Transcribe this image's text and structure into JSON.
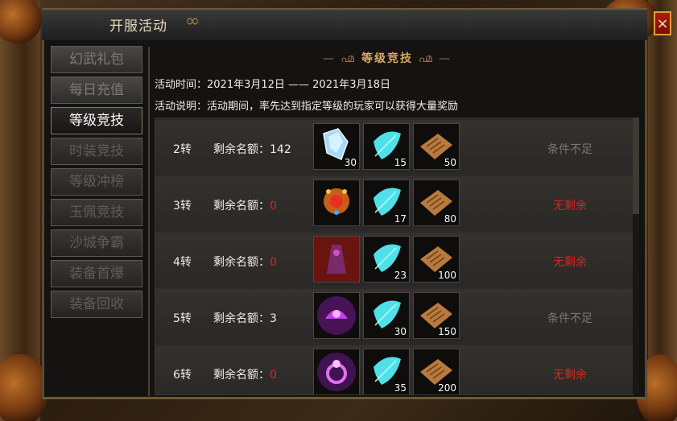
{
  "window": {
    "title": "开服活动",
    "close_label": "×"
  },
  "sidebar": {
    "items": [
      {
        "label": "幻武礼包",
        "state": "normal"
      },
      {
        "label": "每日充值",
        "state": "normal"
      },
      {
        "label": "等级竞技",
        "state": "active"
      },
      {
        "label": "时装竞技",
        "state": "dim"
      },
      {
        "label": "等级冲榜",
        "state": "dim"
      },
      {
        "label": "玉佩竞技",
        "state": "dim"
      },
      {
        "label": "沙城争霸",
        "state": "dim"
      },
      {
        "label": "装备首爆",
        "state": "dim"
      },
      {
        "label": "装备回收",
        "state": "dim"
      }
    ]
  },
  "content": {
    "section_title": "等级竞技",
    "ornament_left": "— ൶",
    "ornament_right": "൶ —",
    "time_label": "活动时间：2021年3月12日 —— 2021年3月18日",
    "desc_label": "活动说明：活动期间，率先达到指定等级的玩家可以获得大量奖励",
    "quota_prefix": "剩余名额：",
    "rows": [
      {
        "level": "2转",
        "quota": "142",
        "rewards": [
          {
            "icon": "crystal-icon",
            "count": "30"
          },
          {
            "icon": "feather-icon",
            "count": "15"
          },
          {
            "icon": "scroll-icon",
            "count": "50"
          }
        ],
        "status": "条件不足",
        "status_type": "fail"
      },
      {
        "level": "3转",
        "quota": "0",
        "rewards": [
          {
            "icon": "gem-amulet-icon",
            "count": ""
          },
          {
            "icon": "feather-icon",
            "count": "17"
          },
          {
            "icon": "scroll-icon",
            "count": "80"
          }
        ],
        "status": "无剩余",
        "status_type": "none"
      },
      {
        "level": "4转",
        "quota": "0",
        "rewards": [
          {
            "icon": "robe-icon",
            "count": ""
          },
          {
            "icon": "feather-icon",
            "count": "23"
          },
          {
            "icon": "scroll-icon",
            "count": "100"
          }
        ],
        "status": "无剩余",
        "status_type": "none"
      },
      {
        "level": "5转",
        "quota": "3",
        "rewards": [
          {
            "icon": "purple-helmet-icon",
            "count": ""
          },
          {
            "icon": "feather-icon",
            "count": "30"
          },
          {
            "icon": "scroll-icon",
            "count": "150"
          }
        ],
        "status": "条件不足",
        "status_type": "fail"
      },
      {
        "level": "6转",
        "quota": "0",
        "rewards": [
          {
            "icon": "purple-ring-icon",
            "count": ""
          },
          {
            "icon": "feather-icon",
            "count": "35"
          },
          {
            "icon": "scroll-icon",
            "count": "200"
          }
        ],
        "status": "无剩余",
        "status_type": "none"
      }
    ]
  },
  "colors": {
    "accent": "#d8a868",
    "none_red": "#d22a22",
    "fail_gray": "#7c7870"
  }
}
